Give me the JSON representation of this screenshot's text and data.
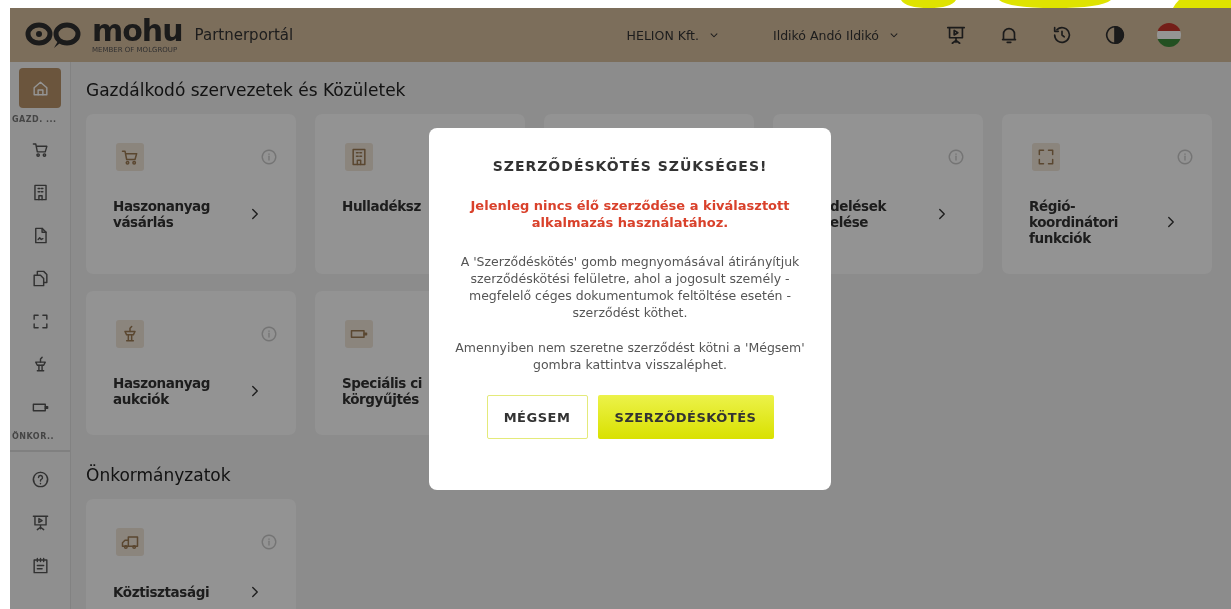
{
  "header": {
    "logo": "mohu",
    "logo_tagline": "MEMBER OF MOLGROUP",
    "portal": "Partnerportál",
    "company": "HELION Kft.",
    "user": "Ildikó Andó Ildikó"
  },
  "sidebar": {
    "items": [
      {
        "kind": "home",
        "selected": true
      },
      {
        "kind": "label",
        "label": "GAZD. ..."
      },
      {
        "kind": "icon",
        "selected": false
      },
      {
        "kind": "icon",
        "selected": false
      },
      {
        "kind": "icon",
        "selected": false
      },
      {
        "kind": "icon",
        "selected": false
      },
      {
        "kind": "icon",
        "selected": false
      },
      {
        "kind": "icon",
        "selected": false
      },
      {
        "kind": "icon",
        "selected": false
      },
      {
        "kind": "label",
        "label": "ÖNKOR.."
      },
      {
        "kind": "icon",
        "selected": false,
        "divider_above": true
      },
      {
        "kind": "icon",
        "selected": false
      },
      {
        "kind": "icon",
        "selected": false
      }
    ]
  },
  "sections": [
    {
      "title": "Gazdálkodó szervezetek és Közületek",
      "cards": [
        {
          "kind": "full",
          "title_lines": [
            "Haszonanyag",
            "vásárlás"
          ]
        },
        {
          "kind": "partial",
          "title_lines": [
            "Hulladéksz"
          ]
        },
        {
          "kind": "covered"
        },
        {
          "kind": "cut",
          "title_lines": [
            "delések",
            "elése"
          ]
        },
        {
          "kind": "full",
          "title_lines": [
            "Régió-",
            "koordinátori",
            "funkciók"
          ]
        },
        {
          "kind": "full",
          "title_lines": [
            "Haszonanyag",
            "aukciók"
          ]
        },
        {
          "kind": "partial",
          "title_lines": [
            "Speciális ci",
            "körgyűjtés"
          ]
        }
      ]
    },
    {
      "title": "Önkormányzatok",
      "cards": [
        {
          "kind": "full",
          "title_lines": [
            "Köztisztasági"
          ]
        }
      ]
    }
  ],
  "modal": {
    "title": "SZERZŐDÉSKÖTÉS SZÜKSÉGES!",
    "warning": "Jelenleg nincs élő szerződése a kiválasztott alkalmazás használatához.",
    "paragraphs": [
      "A 'Szerződéskötés' gomb megnyomásával átirányítjuk szerződéskötési felületre, ahol a jogosult személy - megfelelő céges dokumentumok feltöltése esetén - szerződést köthet.",
      "Amennyiben nem szeretne szerződést kötni a 'Mégsem' gombra kattintva visszaléphet."
    ],
    "buttons": [
      {
        "kind": "secondary",
        "label": "MÉGSEM"
      },
      {
        "kind": "primary",
        "label": "SZERZŐDÉSKÖTÉS"
      }
    ]
  }
}
